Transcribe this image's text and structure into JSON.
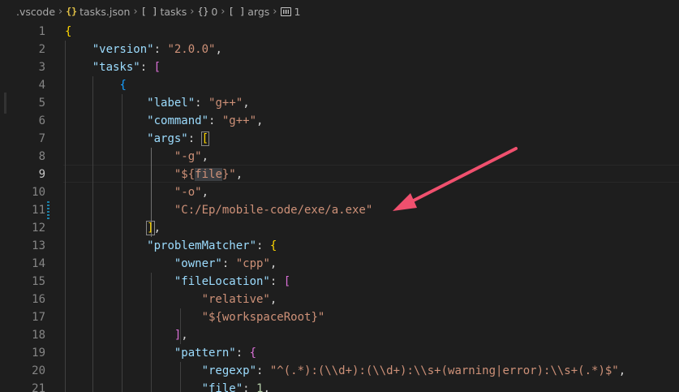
{
  "breadcrumb": {
    "items": [
      {
        "icon": "folder",
        "label": ".vscode"
      },
      {
        "icon": "json-braces-icon",
        "glyph": "{}",
        "label": "tasks.json"
      },
      {
        "icon": "array-icon",
        "glyph": "[ ]",
        "label": "tasks"
      },
      {
        "icon": "object-icon",
        "glyph": "{}",
        "label": "0"
      },
      {
        "icon": "array-icon",
        "glyph": "[ ]",
        "label": "args"
      },
      {
        "icon": "number-icon",
        "glyph": "",
        "label": "1"
      }
    ]
  },
  "editor": {
    "active_line": "9",
    "modified_line": "11",
    "line_numbers": [
      "1",
      "2",
      "3",
      "4",
      "5",
      "6",
      "7",
      "8",
      "9",
      "10",
      "11",
      "12",
      "13",
      "14",
      "15",
      "16",
      "17",
      "18",
      "19",
      "20",
      "21"
    ],
    "tokens": {
      "open_brace": "{",
      "close_brace": "}",
      "open_bracket": "[",
      "close_bracket": "]",
      "colon": ": ",
      "comma": ",",
      "quote": "\"",
      "version_key": "\"version\"",
      "version_val": "\"2.0.0\"",
      "tasks_key": "\"tasks\"",
      "label_key": "\"label\"",
      "label_val": "\"g++\"",
      "command_key": "\"command\"",
      "command_val": "\"g++\"",
      "args_key": "\"args\"",
      "arg_g": "\"-g\"",
      "arg_file_prefix": "\"${",
      "arg_file_word": "file",
      "arg_file_suffix": "}\"",
      "arg_o": "\"-o\"",
      "arg_out": "\"C:/Ep/mobile-code/exe/a.exe\"",
      "problem_key": "\"problemMatcher\"",
      "owner_key": "\"owner\"",
      "owner_val": "\"cpp\"",
      "fileloc_key": "\"fileLocation\"",
      "rel_val": "\"relative\"",
      "ws_val": "\"${workspaceRoot}\"",
      "pattern_key": "\"pattern\"",
      "regexp_key": "\"regexp\"",
      "regexp_val": "\"^(.*):(\\\\d+):(\\\\d+):\\\\s+(warning|error):\\\\s+(.*)$\"",
      "file_key": "\"file\"",
      "file_val": "1"
    }
  },
  "colors": {
    "background": "#1e1e1e",
    "key": "#9cdcfe",
    "string": "#ce9178",
    "number": "#b5cea8",
    "bracket_level1": "#ffd700",
    "bracket_level2": "#da70d6",
    "bracket_level3": "#179fff",
    "annotation_arrow": "#f0506e"
  }
}
